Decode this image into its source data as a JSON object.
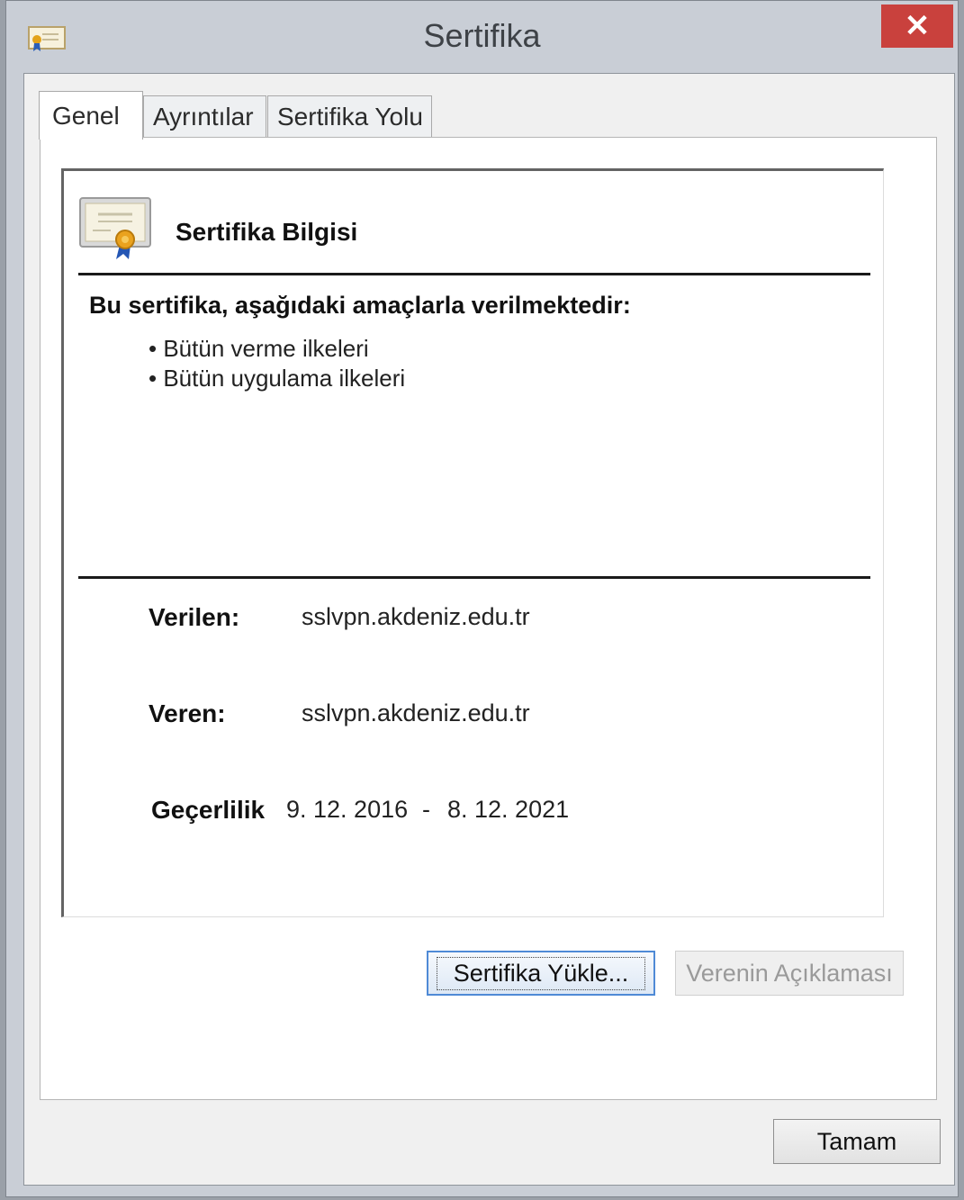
{
  "window": {
    "title": "Sertifika",
    "close_glyph": "✕"
  },
  "tabs": [
    {
      "label": "Genel",
      "active": true
    },
    {
      "label": "Ayrıntılar",
      "active": false
    },
    {
      "label": "Sertifika Yolu",
      "active": false
    }
  ],
  "info": {
    "heading": "Sertifika Bilgisi",
    "purpose_heading": "Bu sertifika, aşağıdaki amaçlarla verilmektedir:",
    "purposes": [
      "Bütün verme ilkeleri",
      "Bütün uygulama ilkeleri"
    ],
    "issued_to_label": "Verilen:",
    "issued_to_value": "sslvpn.akdeniz.edu.tr",
    "issued_by_label": "Veren:",
    "issued_by_value": "sslvpn.akdeniz.edu.tr",
    "validity_label": "Geçerlilik",
    "valid_from": "9. 12. 2016",
    "valid_separator": "-",
    "valid_to": "8. 12. 2021"
  },
  "buttons": {
    "install": "Sertifika Yükle...",
    "issuer_statement": "Verenin Açıklaması",
    "ok": "Tamam"
  },
  "icons": [
    "certificate-icon",
    "close-icon"
  ],
  "colors": {
    "close_button": "#c9413d",
    "focus_border": "#4f8ad6"
  }
}
